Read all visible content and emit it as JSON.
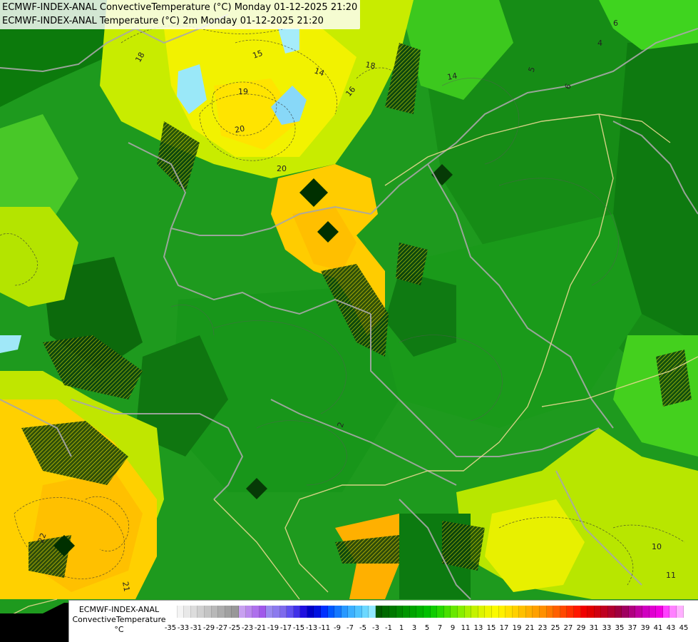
{
  "title": {
    "line1": "ECMWF-INDEX-ANAL ConvectiveTemperature (°C) Monday 01-12-2025 21:20",
    "line2": "ECMWF-INDEX-ANAL Temperature (°C) 2m Monday 01-12-2025 21:20"
  },
  "legend": {
    "title_line1": "ECMWF-INDEX-ANAL",
    "title_line2": "ConvectiveTemperature",
    "unit": "°C",
    "labels": [
      "-35",
      "-33",
      "-31",
      "-29",
      "-27",
      "-25",
      "-23",
      "-21",
      "-19",
      "-17",
      "-15",
      "-13",
      "-11",
      "-9",
      "-7",
      "-5",
      "-3",
      "-1",
      "1",
      "3",
      "5",
      "7",
      "9",
      "11",
      "13",
      "15",
      "17",
      "19",
      "21",
      "23",
      "25",
      "27",
      "29",
      "31",
      "33",
      "35",
      "37",
      "39",
      "41",
      "43",
      "45"
    ],
    "colors": [
      "#ffffff",
      "#f4f4f4",
      "#e8e8e8",
      "#dcdcdc",
      "#d0d0d0",
      "#c4c4c4",
      "#b8b8b8",
      "#acacac",
      "#a0a0a0",
      "#989898",
      "#c8a0f0",
      "#bb88ee",
      "#ae70ec",
      "#a058ea",
      "#9a8af0",
      "#8c7aee",
      "#7e6aec",
      "#6050f0",
      "#4030e8",
      "#2010e0",
      "#0000c8",
      "#0010e0",
      "#0030ff",
      "#0058ff",
      "#1478ff",
      "#2898ff",
      "#3cb0ff",
      "#50c4ff",
      "#6cd8ff",
      "#90e8ff",
      "#005a00",
      "#006a00",
      "#007800",
      "#008800",
      "#009600",
      "#00a400",
      "#00b200",
      "#00c000",
      "#10cc00",
      "#28d800",
      "#48e000",
      "#68e800",
      "#88ee00",
      "#a8f000",
      "#c4f200",
      "#dcf400",
      "#eef600",
      "#fafa00",
      "#fff000",
      "#ffe000",
      "#ffd000",
      "#ffc000",
      "#ffb000",
      "#ffa000",
      "#ff9000",
      "#ff7800",
      "#ff6000",
      "#ff4800",
      "#ff3000",
      "#ff1800",
      "#f00000",
      "#e00000",
      "#d00010",
      "#c00020",
      "#b00030",
      "#a00040",
      "#a00060",
      "#b00080",
      "#c000a0",
      "#d000c0",
      "#e000d0",
      "#f000e0",
      "#ff40ff",
      "#ff80ff",
      "#ffb0ff"
    ]
  },
  "contour_labels": [
    "18",
    "15",
    "14",
    "18",
    "19",
    "20",
    "16",
    "14",
    "20",
    "5",
    "6",
    "4",
    "22",
    "21",
    "10",
    "11",
    "6",
    "2"
  ]
}
